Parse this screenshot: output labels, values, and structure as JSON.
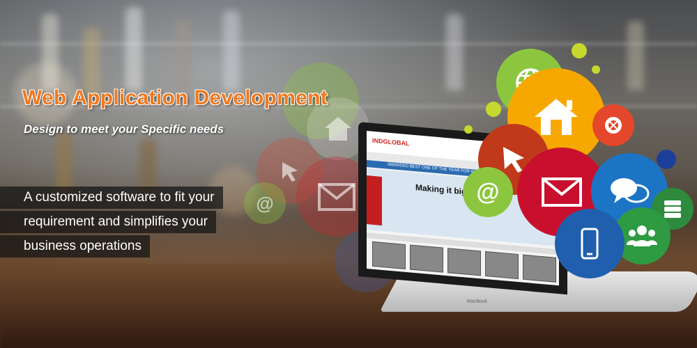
{
  "banner": {
    "title": "Web Application Development",
    "subtitle": "Design to meet your Specific needs",
    "description_lines": [
      "A customized software to fit your",
      "requirement and simplifies your",
      "business operations"
    ]
  },
  "laptop": {
    "brand": "MacBook",
    "screen": {
      "logo": "INDGLOBAL",
      "banner_text": "AWARDED BEST ONE OF THE YEAR FOR WEB DESIGNING",
      "hero_heading": "Making it big online"
    }
  },
  "icons": [
    {
      "name": "globe-icon",
      "color": "#8cc63f"
    },
    {
      "name": "home-icon",
      "color": "#f7a800"
    },
    {
      "name": "browser-icon",
      "color": "#e4472b"
    },
    {
      "name": "cursor-icon",
      "color": "#c0391b"
    },
    {
      "name": "at-icon",
      "color": "#8cc63f"
    },
    {
      "name": "mail-icon",
      "color": "#c8102e"
    },
    {
      "name": "chat-icon",
      "color": "#1c74c4"
    },
    {
      "name": "server-icon",
      "color": "#2e8b3d"
    },
    {
      "name": "users-icon",
      "color": "#2e9b42"
    },
    {
      "name": "mobile-icon",
      "color": "#1f5fae"
    }
  ]
}
